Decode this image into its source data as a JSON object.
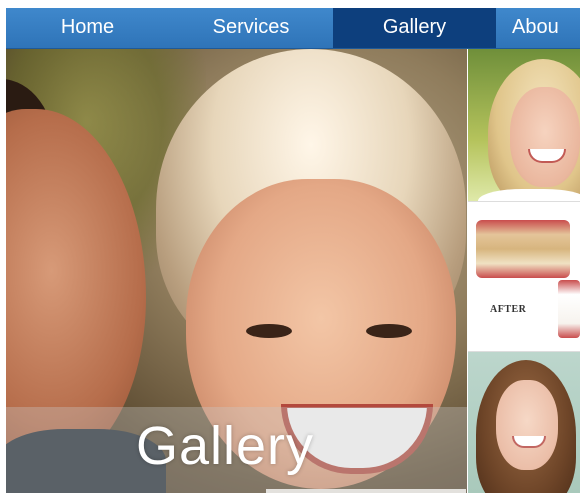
{
  "nav": {
    "items": [
      {
        "label": "Home",
        "active": false
      },
      {
        "label": "Services",
        "active": false
      },
      {
        "label": "Gallery",
        "active": true
      },
      {
        "label": "Abou",
        "active": false
      }
    ],
    "bar_color": "#3a82c4",
    "active_color": "#0d3f7d",
    "text_color": "#ffffff"
  },
  "hero": {
    "title": "Gallery"
  },
  "thumbnails": [
    {
      "kind": "portrait"
    },
    {
      "kind": "before-after",
      "label": "AFTER"
    },
    {
      "kind": "portrait"
    }
  ]
}
